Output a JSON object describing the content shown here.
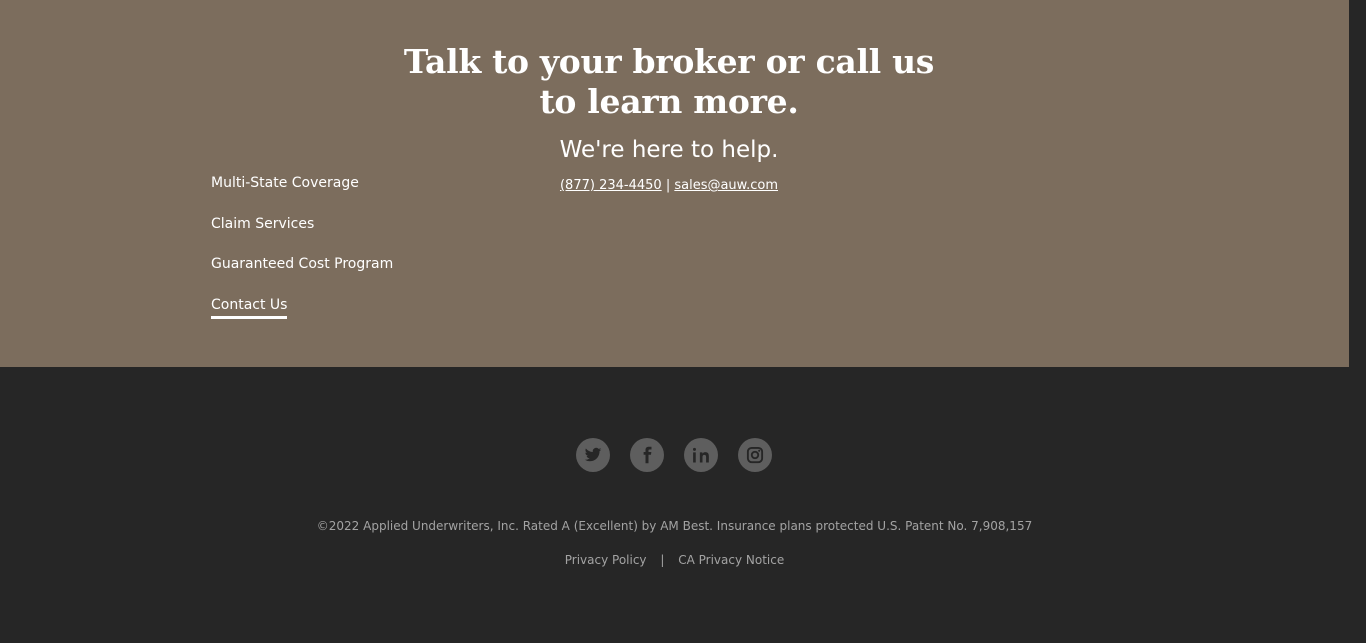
{
  "cta": {
    "headline_line1": "Talk to your broker or call us",
    "headline_line2": "to learn more.",
    "subhead": "We're here to help.",
    "phone": "(877) 234-4450",
    "separator": "|",
    "email": "sales@auw.com"
  },
  "nav": {
    "items": [
      {
        "label": "Multi-State Coverage"
      },
      {
        "label": "Claim Services"
      },
      {
        "label": "Guaranteed Cost Program"
      },
      {
        "label": "Contact Us",
        "active": true
      }
    ]
  },
  "social": {
    "icons": [
      "twitter-icon",
      "facebook-icon",
      "linkedin-icon",
      "instagram-icon"
    ]
  },
  "footer": {
    "copyright": "©2022 Applied Underwriters, Inc. Rated A (Excellent) by AM Best. Insurance plans protected U.S. Patent No. 7,908,157",
    "privacy_policy": "Privacy Policy",
    "separator": "|",
    "ca_privacy": "CA Privacy Notice"
  },
  "colors": {
    "cta_background": "#7c6d5d",
    "footer_background": "#262626",
    "social_icon_background": "#5e5e5e",
    "footer_text": "#a3a3a3"
  }
}
